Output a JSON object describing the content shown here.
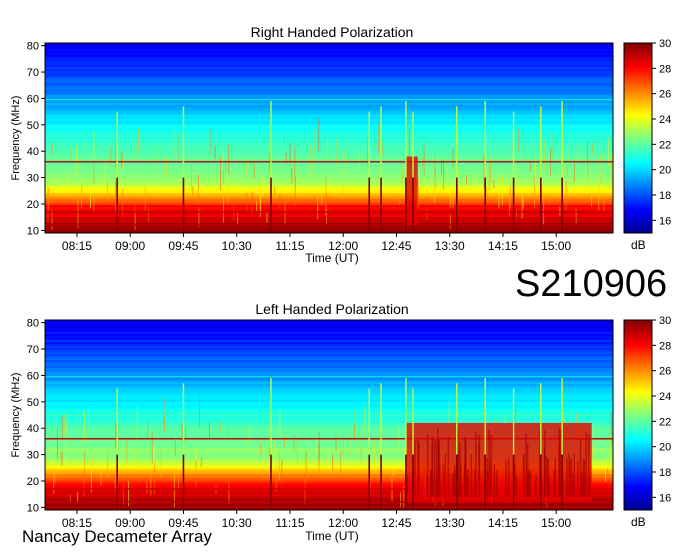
{
  "observation_id": "S210906",
  "footer_text": "Nancay Decameter Array",
  "chart_data": [
    {
      "type": "heatmap",
      "title": "Right Handed Polarization",
      "xlabel": "Time (UT)",
      "ylabel": "Frequency (MHz)",
      "x_ticks": [
        "08:15",
        "09:00",
        "09:45",
        "10:30",
        "11:15",
        "12:00",
        "12:45",
        "13:30",
        "14:15",
        "15:00"
      ],
      "y_ticks": [
        10,
        20,
        30,
        40,
        50,
        60,
        70,
        80
      ],
      "ylim": [
        9,
        81
      ],
      "colorbar": {
        "label": "dB",
        "ticks": [
          16,
          18,
          20,
          22,
          24,
          26,
          28,
          30
        ],
        "range": [
          15,
          30
        ]
      },
      "burst_times": [
        "08:49",
        "09:45",
        "10:59",
        "12:22",
        "12:32",
        "12:53",
        "12:59",
        "13:36",
        "14:00",
        "14:24",
        "14:47",
        "15:05"
      ],
      "storm_interval": [
        "12:53",
        "13:03"
      ]
    },
    {
      "type": "heatmap",
      "title": "Left Handed Polarization",
      "xlabel": "Time (UT)",
      "ylabel": "Frequency (MHz)",
      "x_ticks": [
        "08:15",
        "09:00",
        "09:45",
        "10:30",
        "11:15",
        "12:00",
        "12:45",
        "13:30",
        "14:15",
        "15:00"
      ],
      "y_ticks": [
        10,
        20,
        30,
        40,
        50,
        60,
        70,
        80
      ],
      "ylim": [
        9,
        81
      ],
      "colorbar": {
        "label": "dB",
        "ticks": [
          16,
          18,
          20,
          22,
          24,
          26,
          28,
          30
        ],
        "range": [
          15,
          30
        ]
      },
      "burst_times": [
        "08:49",
        "09:45",
        "10:59",
        "12:22",
        "12:32",
        "12:53",
        "12:59",
        "13:36",
        "14:00",
        "14:24",
        "14:47",
        "15:05"
      ],
      "storm_interval": [
        "12:53",
        "15:30"
      ]
    }
  ],
  "colors": {
    "colormap": [
      "#00008f",
      "#0000ff",
      "#0080ff",
      "#00ffff",
      "#80ff80",
      "#ffff00",
      "#ff8000",
      "#ff0000",
      "#800000"
    ]
  }
}
